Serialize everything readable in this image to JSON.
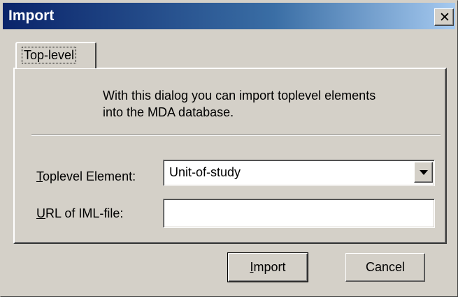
{
  "window": {
    "title": "Import",
    "close_glyph": "✕"
  },
  "tabs": [
    {
      "label": "Top-level",
      "selected": true
    }
  ],
  "panel": {
    "description_line1": "With this dialog you can import toplevel elements",
    "description_line2": "into the MDA database."
  },
  "form": {
    "toplevel_label": {
      "mnemonic": "T",
      "rest": "oplevel Element:"
    },
    "toplevel_value": "Unit-of-study",
    "url_label": {
      "mnemonic": "U",
      "rest": "RL of IML-file:"
    },
    "url_value": ""
  },
  "buttons": {
    "import": {
      "mnemonic": "I",
      "rest": "mport"
    },
    "cancel": "Cancel"
  },
  "colors": {
    "face": "#d4d0c8",
    "title_start": "#0a246a",
    "title_end": "#a6caf0"
  }
}
